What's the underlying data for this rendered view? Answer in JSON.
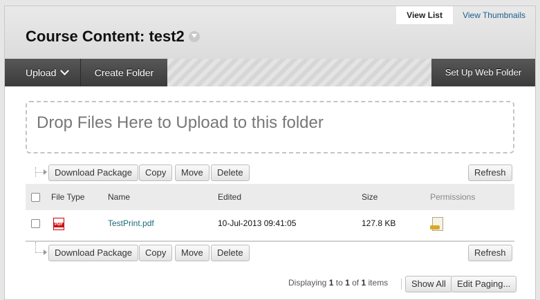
{
  "view_tabs": {
    "list": "View List",
    "thumbnails": "View Thumbnails"
  },
  "page_title": "Course Content: test2",
  "action_bar": {
    "upload": "Upload",
    "create_folder": "Create Folder",
    "set_up_web_folder": "Set Up Web Folder"
  },
  "dropzone": {
    "text": "Drop Files Here to Upload to this folder"
  },
  "toolbar": {
    "download_package": "Download Package",
    "copy": "Copy",
    "move": "Move",
    "delete": "Delete",
    "refresh": "Refresh"
  },
  "table": {
    "columns": {
      "file_type": "File Type",
      "name": "Name",
      "edited": "Edited",
      "size": "Size",
      "permissions": "Permissions"
    },
    "rows": [
      {
        "file_type": "pdf",
        "name": "TestPrint.pdf",
        "edited": "10-Jul-2013 09:41:05",
        "size": "127.8 KB"
      }
    ]
  },
  "paging": {
    "prefix": "Displaying",
    "from": "1",
    "to_word": "to",
    "to": "1",
    "of_word": "of",
    "total": "1",
    "suffix": "items",
    "show_all": "Show All",
    "edit_paging": "Edit Paging..."
  }
}
